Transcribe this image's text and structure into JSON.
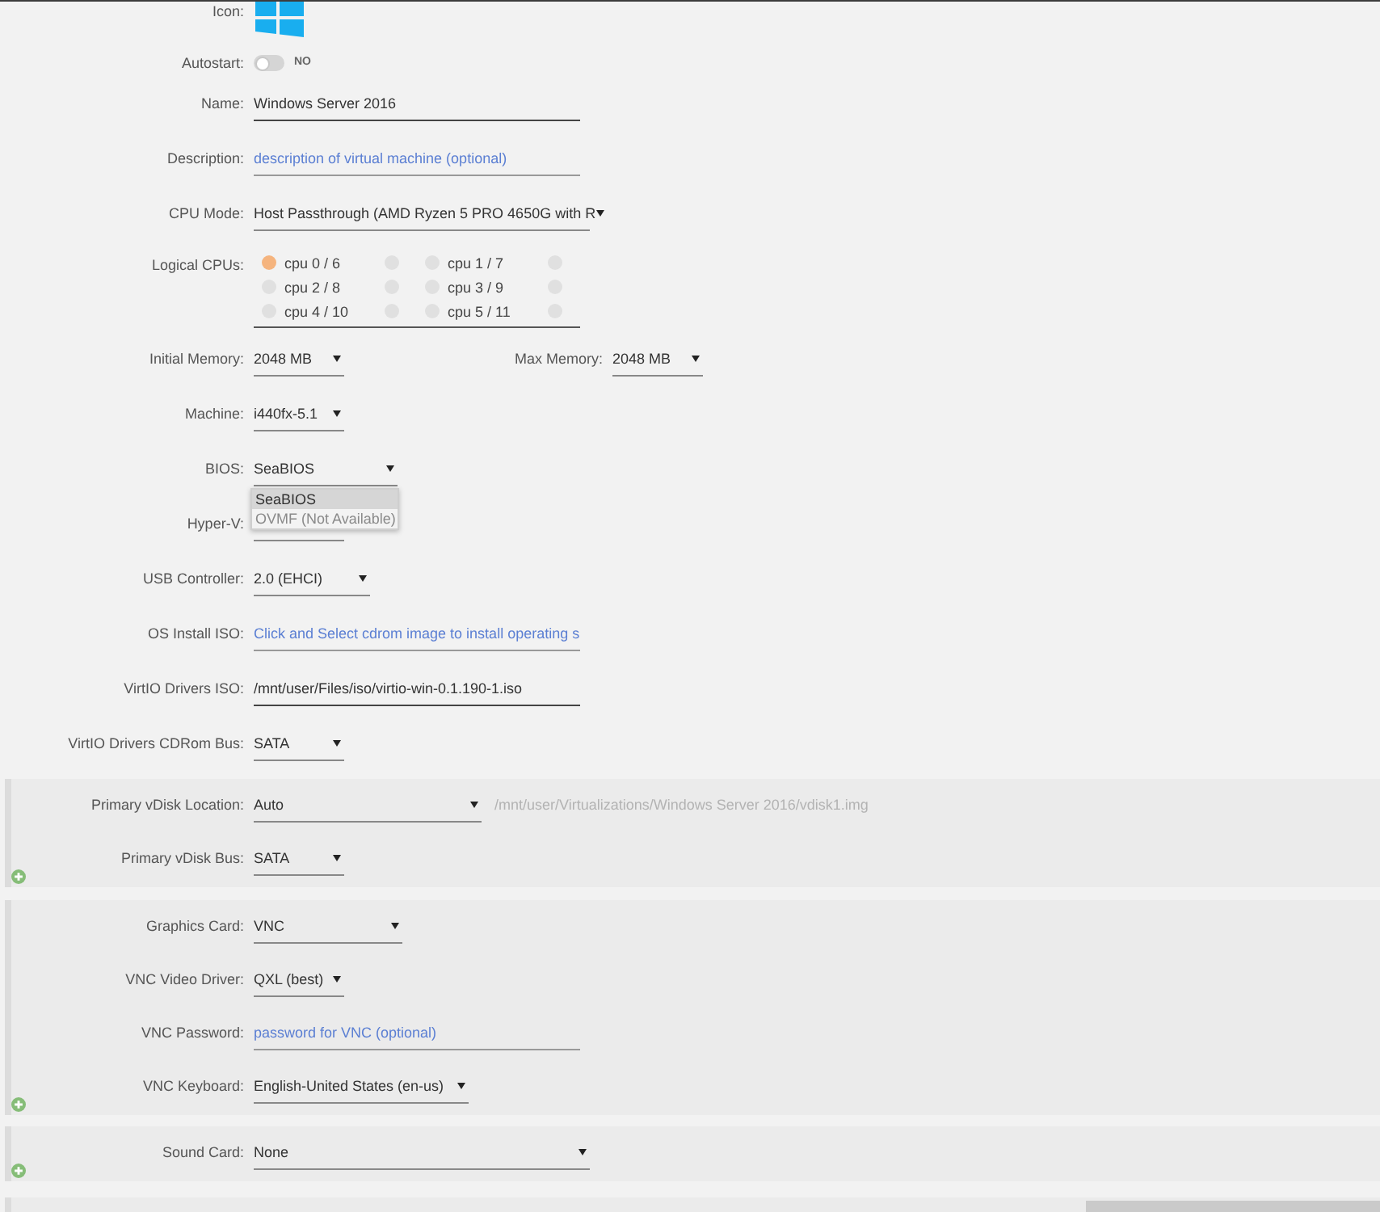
{
  "general": {
    "icon": {
      "label": "Icon:"
    },
    "autostart": {
      "label": "Autostart:",
      "on": false,
      "state_text": "NO"
    },
    "name": {
      "label": "Name:",
      "value": "Windows Server 2016"
    },
    "description": {
      "label": "Description:",
      "placeholder": "description of virtual machine (optional)"
    },
    "cpu_mode": {
      "label": "CPU Mode:",
      "value": "Host Passthrough (AMD Ryzen 5 PRO 4650G with R"
    },
    "logical_cpus": {
      "label": "Logical CPUs:",
      "cores": [
        {
          "label": "cpu 0 / 6",
          "threads": [
            {
              "checked": true
            },
            {
              "checked": false
            }
          ]
        },
        {
          "label": "cpu 1 / 7",
          "threads": [
            {
              "checked": false
            },
            {
              "checked": false
            }
          ]
        },
        {
          "label": "cpu 2 / 8",
          "threads": [
            {
              "checked": false
            },
            {
              "checked": false
            }
          ]
        },
        {
          "label": "cpu 3 / 9",
          "threads": [
            {
              "checked": false
            },
            {
              "checked": false
            }
          ]
        },
        {
          "label": "cpu 4 / 10",
          "threads": [
            {
              "checked": false
            },
            {
              "checked": false
            }
          ]
        },
        {
          "label": "cpu 5 / 11",
          "threads": [
            {
              "checked": false
            },
            {
              "checked": false
            }
          ]
        }
      ]
    },
    "initial_memory": {
      "label": "Initial Memory:",
      "value": "2048 MB"
    },
    "max_memory": {
      "label": "Max Memory:",
      "value": "2048 MB"
    },
    "machine": {
      "label": "Machine:",
      "value": "i440fx-5.1"
    },
    "bios": {
      "label": "BIOS:",
      "value": "SeaBIOS",
      "expanded": true,
      "options": [
        {
          "label": "SeaBIOS",
          "selected": true,
          "disabled": false
        },
        {
          "label": "OVMF (Not Available)",
          "selected": false,
          "disabled": true
        }
      ]
    },
    "hyper_v": {
      "label": "Hyper-V:"
    },
    "usb_controller": {
      "label": "USB Controller:",
      "value": "2.0 (EHCI)"
    },
    "os_install_iso": {
      "label": "OS Install ISO:",
      "placeholder": "Click and Select cdrom image to install operating s"
    },
    "virtio_drivers_iso": {
      "label": "VirtIO Drivers ISO:",
      "value": "/mnt/user/Files/iso/virtio-win-0.1.190-1.iso"
    },
    "virtio_cdrom_bus": {
      "label": "VirtIO Drivers CDRom Bus:",
      "value": "SATA"
    }
  },
  "vdisk": {
    "location": {
      "label": "Primary vDisk Location:",
      "value": "Auto",
      "path": "/mnt/user/Virtualizations/Windows Server 2016/vdisk1.img"
    },
    "bus": {
      "label": "Primary vDisk Bus:",
      "value": "SATA"
    }
  },
  "graphics": {
    "card": {
      "label": "Graphics Card:",
      "value": "VNC"
    },
    "video_driver": {
      "label": "VNC Video Driver:",
      "value": "QXL (best)"
    },
    "password": {
      "label": "VNC Password:",
      "placeholder": "password for VNC (optional)"
    },
    "keyboard": {
      "label": "VNC Keyboard:",
      "value": "English-United States (en-us)"
    }
  },
  "sound": {
    "card": {
      "label": "Sound Card:",
      "value": "None"
    }
  }
}
